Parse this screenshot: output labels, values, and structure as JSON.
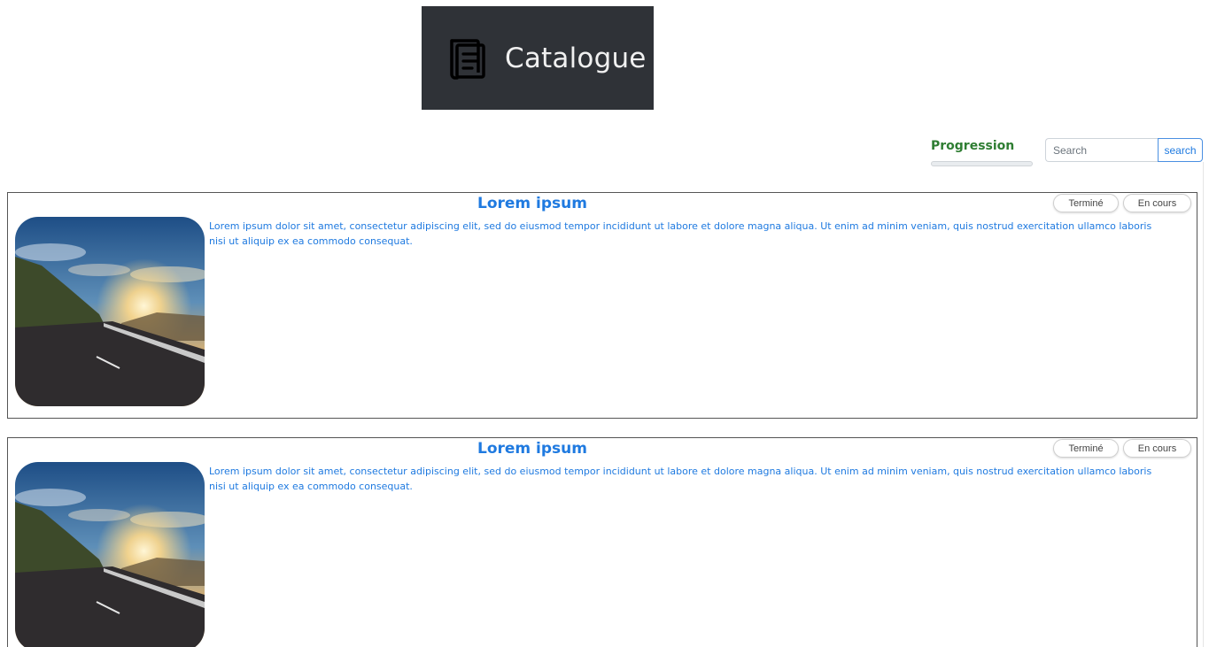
{
  "header": {
    "logo_icon": "book-icon",
    "logo_text": "Catalogue"
  },
  "progress": {
    "label": "Progression",
    "value": 0
  },
  "search": {
    "placeholder": "Search",
    "value": "",
    "button_label": "search"
  },
  "cards": [
    {
      "title": "Lorem ipsum",
      "text": "Lorem ipsum dolor sit amet, consectetur adipiscing elit, sed do eiusmod tempor incididunt ut labore et dolore magna aliqua. Ut enim ad minim veniam, quis nostrud exercitation ullamco laboris nisi ut aliquip ex ea commodo consequat.",
      "buttons": {
        "done": "Terminé",
        "in_progress": "En cours"
      }
    },
    {
      "title": "Lorem ipsum",
      "text": "Lorem ipsum dolor sit amet, consectetur adipiscing elit, sed do eiusmod tempor incididunt ut labore et dolore magna aliqua. Ut enim ad minim veniam, quis nostrud exercitation ullamco laboris nisi ut aliquip ex ea commodo consequat.",
      "buttons": {
        "done": "Terminé",
        "in_progress": "En cours"
      }
    }
  ],
  "colors": {
    "accent": "#1f7ae0",
    "progress_label": "#2e7d32",
    "header_bg": "#2f3237"
  }
}
